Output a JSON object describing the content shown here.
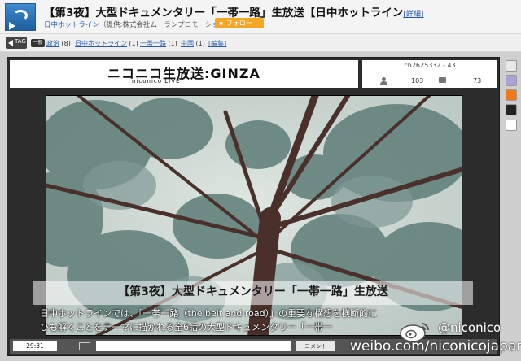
{
  "header": {
    "title": "【第3夜】大型ドキュメンタリー「一帯一路」生放送【日中ホットライン",
    "detail_link": "[詳細]",
    "channel_name": "日中ホットライン",
    "provider": "（提供:株式会社ムーランプロモーション）",
    "follow_button": "★ フォロー"
  },
  "tagbar": {
    "category": "一般",
    "tags": [
      {
        "label": "政治",
        "count": "(8)"
      },
      {
        "label": "日中ホットライン",
        "count": "(1)"
      },
      {
        "label": "一帯一路",
        "count": "(1)"
      },
      {
        "label": "中国",
        "count": "(1)"
      }
    ],
    "edit_link": "[編集]",
    "tag_icon_label": "TAG"
  },
  "player": {
    "logo_main": "ニコニコ生放送:GINZA",
    "logo_sub": "niconico LIVE",
    "room": "ch2625332 - 43",
    "viewers": "103",
    "comments": "73",
    "caption_title": "【第3夜】大型ドキュメンタリー「一帯一路」生放送",
    "caption_line1": "日中ホットラインでは、「一帯一路（the belt and road）」の重要な構想を横断的に",
    "caption_line2": "ひも解くことをテーマに描かれる全6話の大型ドキュメンタリー「一帯一",
    "time": "29:31",
    "comment_button": "コメント",
    "comment_placeholder": ""
  },
  "watermark": {
    "handle": "@niconico",
    "url": "weibo.com/niconicojapan"
  },
  "colors": {
    "accent": "#f5a623",
    "link": "#2a5db0",
    "rail_icons": [
      "#e8e8e8",
      "#b0a0d8",
      "#f07a1a",
      "#222222",
      "#ffffff"
    ]
  }
}
